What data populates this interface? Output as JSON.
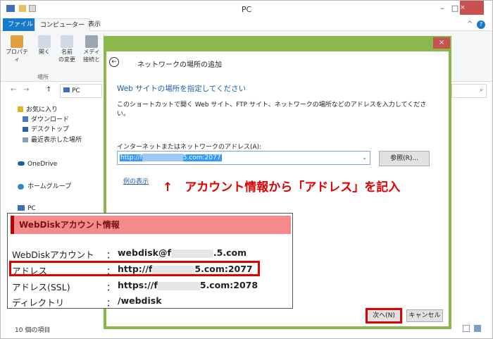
{
  "window": {
    "title": "PC",
    "min": "–",
    "max": "□",
    "close": "×"
  },
  "ribbon": {
    "tabs": [
      "ファイル",
      "コンピューター",
      "表示"
    ],
    "items": [
      {
        "label": "プロパティ",
        "icon": "properties-icon"
      },
      {
        "label": "開く",
        "icon": "open-icon"
      },
      {
        "label": "名前\nの変更",
        "icon": "rename-icon"
      },
      {
        "label": "メディ\n接続と",
        "icon": "media-icon"
      }
    ],
    "group": "場所"
  },
  "address": {
    "path": "PC",
    "back": "←",
    "forward": "→",
    "up": "↑"
  },
  "nav": {
    "items": [
      "お気に入り",
      "ダウンロード",
      "デスクトップ",
      "最近表示した場所",
      "OneDrive",
      "ホームグループ",
      "PC"
    ]
  },
  "status": {
    "items": "10 個の項目"
  },
  "dialog": {
    "title": "ネットワークの場所の追加",
    "heading": "Web サイトの場所を指定してください",
    "description": "このショートカットで開く Web サイト、FTP サイト、ネットワークの場所などのアドレスを入力してください。",
    "address_label": "インターネットまたはネットワークのアドレス(A):",
    "address_prefix": "http://f",
    "address_suffix": "5.com:2077",
    "browse": "参照(R)...",
    "example": "例の表示",
    "next": "次へ(N)",
    "cancel": "キャンセル",
    "close": "×"
  },
  "annotation": "↑　アカウント情報から「アドレス」を記入",
  "card": {
    "title": "WebDiskアカウント情報",
    "rows": [
      {
        "label": "WebDiskアカウント",
        "sep": "：",
        "prefix": "webdisk@f",
        "suffix": ".5.com"
      },
      {
        "label": "アドレス",
        "sep": "：",
        "prefix": "http://f",
        "suffix": "5.com:2077"
      },
      {
        "label": "アドレス(SSL)",
        "sep": "：",
        "prefix": "https://f",
        "suffix": "5.com:2078"
      },
      {
        "label": "ディレクトリ",
        "sep": "：",
        "prefix": "/webdisk",
        "suffix": ""
      }
    ]
  },
  "colors": {
    "accent": "#1979ca",
    "dialog_frame": "#8ab84a",
    "highlight": "#e00000",
    "card_header": "#f68a8a"
  }
}
